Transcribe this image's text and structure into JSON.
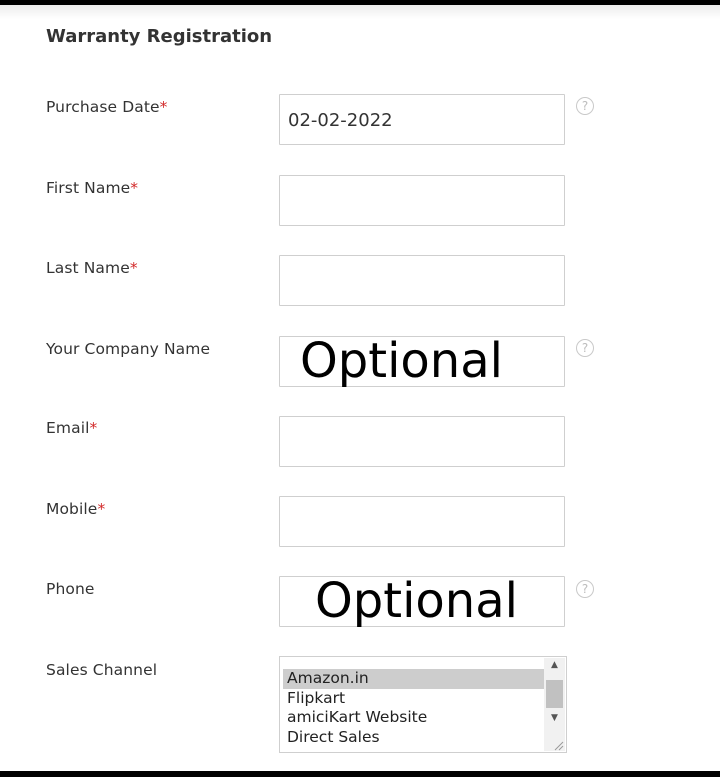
{
  "form": {
    "title": "Warranty Registration",
    "required_marker": "*",
    "help_glyph": "?",
    "fields": {
      "purchase_date": {
        "label": "Purchase Date",
        "value": "02-02-2022"
      },
      "first_name": {
        "label": "First Name",
        "value": ""
      },
      "last_name": {
        "label": "Last Name",
        "value": ""
      },
      "company": {
        "label": "Your Company Name",
        "value": "",
        "annotation": "Optional"
      },
      "email": {
        "label": "Email",
        "value": ""
      },
      "mobile": {
        "label": "Mobile",
        "value": ""
      },
      "phone": {
        "label": "Phone",
        "value": "",
        "annotation": "Optional"
      }
    },
    "sales_channel": {
      "label": "Sales Channel",
      "options": [
        "Amazon.in",
        "Flipkart",
        "amiciKart Website",
        "Direct Sales"
      ],
      "selected": "Amazon.in"
    }
  },
  "colors": {
    "required": "#d22a2a",
    "border": "#cfcfcf",
    "selected_option": "#cdcdcd"
  }
}
